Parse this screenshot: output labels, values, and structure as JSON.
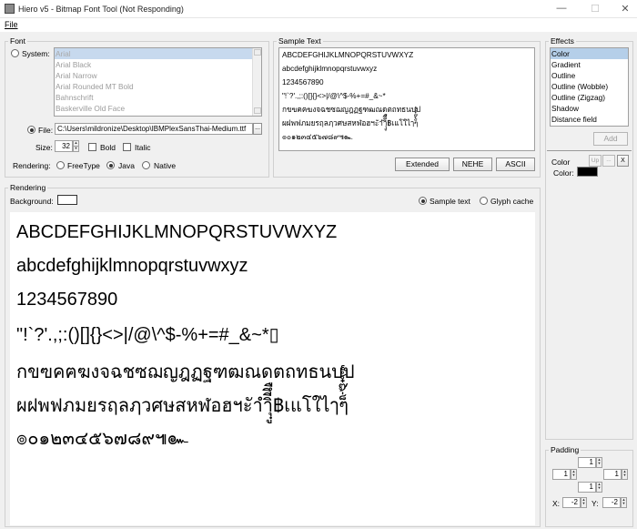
{
  "window": {
    "title": "Hiero v5 - Bitmap Font Tool (Not Responding)",
    "minimize": "—",
    "maximize": "☐",
    "close": "✕"
  },
  "menu": {
    "file": "File"
  },
  "font": {
    "group_title": "Font",
    "system_label": "System:",
    "system_fonts": [
      "Arial",
      "Arial Black",
      "Arial Narrow",
      "Arial Rounded MT Bold",
      "Bahnschrift",
      "Baskerville Old Face"
    ],
    "file_label": "File:",
    "file_path": "C:\\Users\\mildronize\\Desktop\\IBMPlexSansThai-Medium.ttf",
    "browse": "...",
    "size_label": "Size:",
    "size_value": "32",
    "bold_label": "Bold",
    "italic_label": "Italic",
    "rendering_label": "Rendering:",
    "renderers": [
      "FreeType",
      "Java",
      "Native"
    ],
    "selected_renderer": "Java"
  },
  "sample_text": {
    "group_title": "Sample Text",
    "lines": [
      "ABCDEFGHIJKLMNOPQRSTUVWXYZ",
      "abcdefghijklmnopqrstuvwxyz",
      "1234567890",
      "\"!`?'.,;:()[]{}<>|/@\\^$-%+=#_&~*",
      "กขฃคฅฆงจฉชซฌญฎฏฐฑฒณดตถทธนบป",
      "ผฝพฟภมยรฤลฦวศษสหฬอฮฯะัาำิีึืฺุู฿เแโใไๅๆ็่้๊๋์ํ๎",
      "๏๐๑๒๓๔๕๖๗๘๙๚๛"
    ],
    "buttons": [
      "Extended",
      "NEHE",
      "ASCII"
    ]
  },
  "rendering": {
    "group_title": "Rendering",
    "background_label": "Background:",
    "background_color": "#ffffff",
    "view_options": [
      "Sample text",
      "Glyph cache"
    ],
    "selected_view": "Sample text",
    "preview_lines": [
      "ABCDEFGHIJKLMNOPQRSTUVWXYZ",
      "abcdefghijklmnopqrstuvwxyz",
      "1234567890",
      "\"!`?'.,;:()[]{}<>|/@\\^$-%+=#_&~*▯",
      "กขฃคฅฆงจฉชซฌญฎฏฐฑฒณดตถทธนบป",
      "ผฝพฟภมยรฤลฦวศษสหฬอฮฯะัาำิีึืฺุู฿เแโใไๅๆ็่้๊๋์ํ๎",
      "๏๐๑๒๓๔๕๖๗๘๙๚๛"
    ]
  },
  "effects": {
    "group_title": "Effects",
    "items": [
      "Color",
      "Gradient",
      "Outline",
      "Outline (Wobble)",
      "Outline (Zigzag)",
      "Shadow",
      "Distance field"
    ],
    "selected": "Color",
    "add_button": "Add",
    "applied": {
      "name": "Color",
      "up": "Up",
      "more": "...",
      "remove": "X",
      "color_label": "Color:",
      "color_value": "#000000"
    }
  },
  "padding": {
    "group_title": "Padding",
    "top": "1",
    "left": "1",
    "right": "1",
    "bottom": "1",
    "x_label": "X:",
    "x_value": "-2",
    "y_label": "Y:",
    "y_value": "-2"
  }
}
